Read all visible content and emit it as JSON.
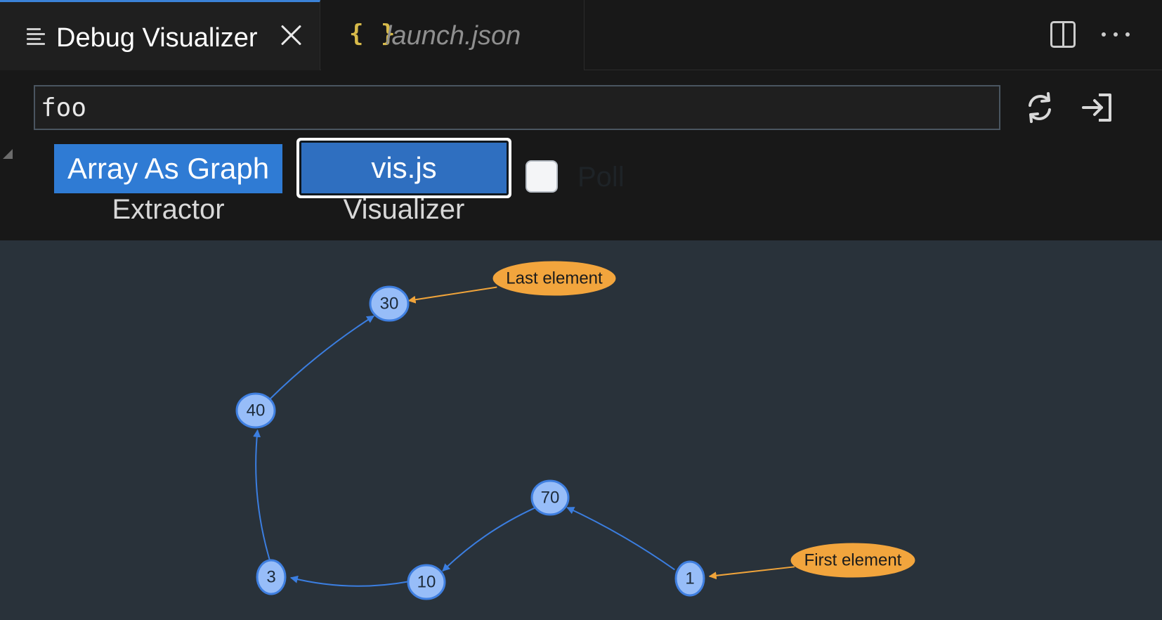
{
  "tabs": [
    {
      "label": "Debug Visualizer",
      "active": true,
      "icon": "preview-lines-icon"
    },
    {
      "label": "launch.json",
      "active": false,
      "icon": "json-braces-icon",
      "icon_text": "{ }"
    }
  ],
  "toolbar": {
    "expression_value": "foo",
    "extractor": {
      "value": "Array As Graph",
      "caption": "Extractor"
    },
    "visualizer": {
      "value": "vis.js",
      "caption": "Visualizer"
    },
    "poll": {
      "label": "Poll",
      "checked": false
    }
  },
  "graph": {
    "nodes": [
      {
        "id": "n1",
        "label": "1"
      },
      {
        "id": "n70",
        "label": "70"
      },
      {
        "id": "n10",
        "label": "10"
      },
      {
        "id": "n3",
        "label": "3"
      },
      {
        "id": "n40",
        "label": "40"
      },
      {
        "id": "n30",
        "label": "30"
      }
    ],
    "edges": [
      {
        "from": "n1",
        "to": "n70"
      },
      {
        "from": "n70",
        "to": "n10"
      },
      {
        "from": "n10",
        "to": "n3"
      },
      {
        "from": "n3",
        "to": "n40"
      },
      {
        "from": "n40",
        "to": "n30"
      }
    ],
    "annotations": [
      {
        "id": "first",
        "label": "First element",
        "target": "n1"
      },
      {
        "id": "last",
        "label": "Last element",
        "target": "n30"
      }
    ],
    "colors": {
      "node_fill": "#97bdf8",
      "node_border": "#3f7fe0",
      "edge": "#3b7ee0",
      "annotation": "#f2a53d",
      "background": "#29323a"
    }
  }
}
